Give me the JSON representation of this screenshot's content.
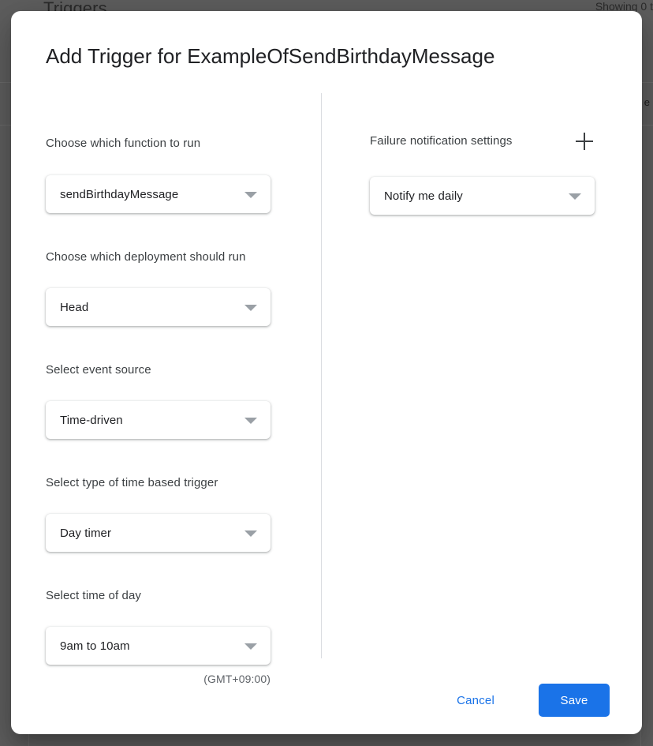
{
  "background": {
    "page_title": "Triggers",
    "showing_text": "Showing 0 t",
    "edge_glyph": "e"
  },
  "dialog": {
    "title": "Add Trigger for ExampleOfSendBirthdayMessage",
    "left_fields": [
      {
        "label": "Choose which function to run",
        "value": "sendBirthdayMessage",
        "name": "function-to-run"
      },
      {
        "label": "Choose which deployment should run",
        "value": "Head",
        "name": "deployment-to-run"
      },
      {
        "label": "Select event source",
        "value": "Time-driven",
        "name": "event-source"
      },
      {
        "label": "Select type of time based trigger",
        "value": "Day timer",
        "name": "time-based-trigger-type"
      },
      {
        "label": "Select time of day",
        "value": "9am to 10am",
        "name": "time-of-day"
      }
    ],
    "timezone_note": "(GMT+09:00)",
    "right_column": {
      "label": "Failure notification settings",
      "add_icon": "plus-icon",
      "value": "Notify me daily"
    },
    "footer": {
      "cancel_label": "Cancel",
      "save_label": "Save"
    },
    "chevron_icon": "chevron-down-icon"
  },
  "colors": {
    "accent_blue": "#1a73e8",
    "text_primary": "#202124",
    "text_secondary": "#3c4043",
    "divider": "#dadce0",
    "scrim": "#5e5e5e"
  }
}
